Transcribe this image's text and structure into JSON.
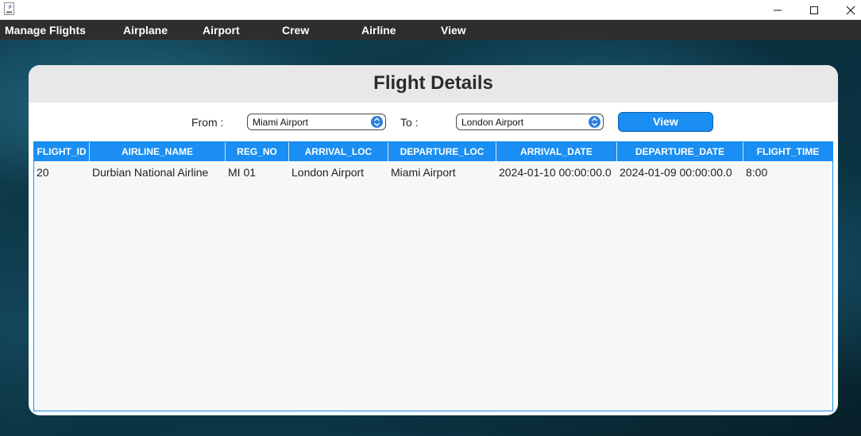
{
  "window": {
    "app_icon": "java-app-icon",
    "controls": [
      "minimize-icon",
      "maximize-icon",
      "close-icon"
    ]
  },
  "menu": {
    "items": [
      "Manage Flights",
      "Airplane",
      "Airport",
      "Crew",
      "Airline",
      "View"
    ]
  },
  "panel": {
    "title": "Flight Details",
    "from_label": "From :",
    "from_value": "Miami Airport",
    "to_label": "To :",
    "to_value": "London Airport",
    "view_button": "View"
  },
  "table": {
    "columns": [
      "FLIGHT_ID",
      "AIRLINE_NAME",
      "REG_NO",
      "ARRIVAL_LOC",
      "DEPARTURE_LOC",
      "ARRIVAL_DATE",
      "DEPARTURE_DATE",
      "FLIGHT_TIME"
    ],
    "rows": [
      [
        "20",
        "Durbian National Airline",
        "MI 01",
        "London Airport",
        "Miami Airport",
        "2024-01-10 00:00:00.0",
        "2024-01-09 00:00:00.0",
        "8:00"
      ]
    ]
  },
  "colors": {
    "accent": "#1a8ef2",
    "menubar": "#2e2e2e",
    "header_bg": "#e8e8e8"
  }
}
